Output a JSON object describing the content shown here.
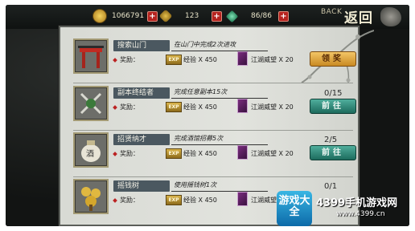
{
  "topbar": {
    "coins": "1066791",
    "ingots": "123",
    "stamina": "86/86",
    "back_en": "BACK",
    "back_cn": "返回"
  },
  "tasks": [
    {
      "title": "搜索山门",
      "desc": "在山门中完成2次进攻",
      "reward_label": "奖励：",
      "exp_icon": "EXP",
      "exp": "经验 X 450",
      "prestige": "江湖威望 X 20",
      "progress": "",
      "button": "领奖",
      "button_type": "claim"
    },
    {
      "title": "副本终结者",
      "desc": "完成任意副本15次",
      "reward_label": "奖励：",
      "exp_icon": "EXP",
      "exp": "经验 X 450",
      "prestige": "江湖威望 X 20",
      "progress": "0/15",
      "button": "前往",
      "button_type": "go"
    },
    {
      "title": "招贤纳才",
      "desc": "完成酒馆招募5次",
      "reward_label": "奖励：",
      "exp_icon": "EXP",
      "exp": "经验 X 450",
      "prestige": "江湖威望 X 20",
      "progress": "2/5",
      "button": "前往",
      "button_type": "go"
    },
    {
      "title": "摇钱树",
      "desc": "使用摇钱树1次",
      "reward_label": "奖励：",
      "exp_icon": "EXP",
      "exp": "经验 X 450",
      "prestige": "江湖威望 X 20",
      "progress": "0/1",
      "button": "",
      "button_type": "go"
    }
  ],
  "watermark": {
    "logo": "游戏大全",
    "site_name": "4399手机游戏网",
    "url": "www.4399.cn"
  },
  "colors": {
    "claim": "#e0a842",
    "go": "#2f8a78",
    "title_bg": "#4b5860"
  }
}
